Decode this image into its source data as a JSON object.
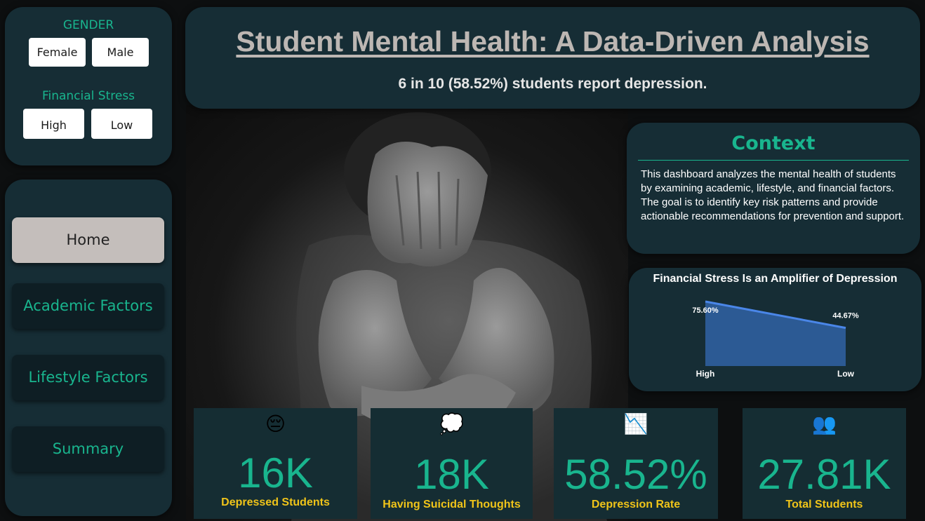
{
  "filters": {
    "gender": {
      "title": "GENDER",
      "options": [
        "Female",
        "Male"
      ]
    },
    "financial_stress": {
      "title": "Financial Stress",
      "options": [
        "High",
        "Low"
      ]
    }
  },
  "nav": {
    "items": [
      {
        "label": "Home",
        "active": true
      },
      {
        "label": "Academic Factors",
        "active": false
      },
      {
        "label": "Lifestyle Factors",
        "active": false
      },
      {
        "label": "Summary",
        "active": false
      }
    ]
  },
  "header": {
    "title": "Student Mental Health: A Data-Driven Analysis",
    "subtitle": "6 in 10 (58.52%) students report depression."
  },
  "context": {
    "title": "Context",
    "body": "This dashboard analyzes the mental health of students by examining academic, lifestyle, and financial factors. The goal is to identify key risk patterns and provide actionable recommendations for prevention and support."
  },
  "chart_data": {
    "type": "area",
    "title": "Financial Stress Is an Amplifier of Depression",
    "categories": [
      "High",
      "Low"
    ],
    "values": [
      75.6,
      44.67
    ],
    "data_labels": [
      "75.60%",
      "44.67%"
    ],
    "xlabel": "",
    "ylabel": "",
    "grid": false,
    "colors": {
      "line": "#4a86e8",
      "fill": "#2c5a94"
    }
  },
  "kpis": [
    {
      "icon": "pensive-face-icon",
      "glyph": "😔",
      "value": "16K",
      "label": "Depressed Students"
    },
    {
      "icon": "thought-balloon-icon",
      "glyph": "💭",
      "value": "18K",
      "label": "Having Suicidal Thoughts"
    },
    {
      "icon": "chart-decreasing-icon",
      "glyph": "📉",
      "value": "58.52%",
      "label": "Depression Rate"
    },
    {
      "icon": "people-icon",
      "glyph": "👥",
      "value": "27.81K",
      "label": "Total Students"
    }
  ],
  "colors": {
    "accent": "#19b58e",
    "panel": "#162d35",
    "kpi_label": "#f0c419"
  }
}
